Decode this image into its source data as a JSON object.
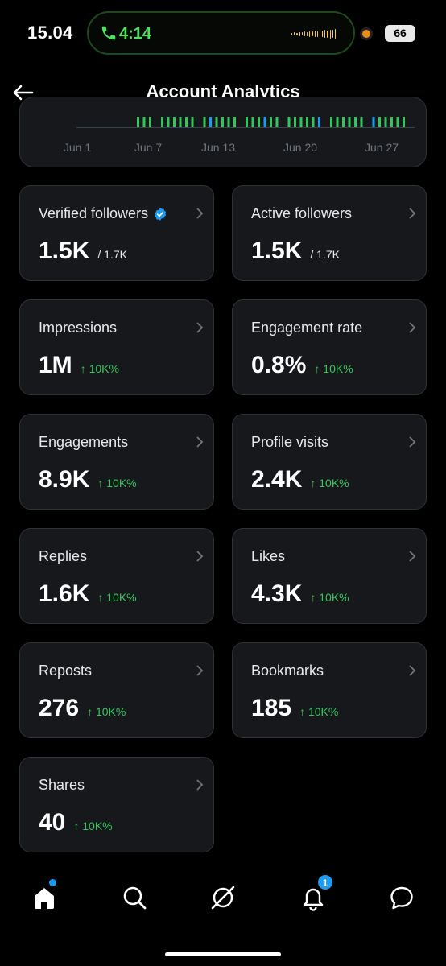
{
  "status_bar": {
    "time": "15.04",
    "call_time": "4:14",
    "battery": "66"
  },
  "header": {
    "title": "Account Analytics"
  },
  "chart": {
    "x_tick_labels": [
      "Jun 1",
      "Jun 7",
      "Jun 13",
      "Jun 20",
      "Jun 27"
    ],
    "bar_color": "#36c55d",
    "highlight_color": "#1d9bf0"
  },
  "cards": [
    {
      "label": "Verified followers",
      "value": "1.5K",
      "sub": "/ 1.7K",
      "delta": ""
    },
    {
      "label": "Active followers",
      "value": "1.5K",
      "sub": "/ 1.7K",
      "delta": ""
    },
    {
      "label": "Impressions",
      "value": "1M",
      "sub": "",
      "delta": "↑ 10K%"
    },
    {
      "label": "Engagement rate",
      "value": "0.8%",
      "sub": "",
      "delta": "↑ 10K%"
    },
    {
      "label": "Engagements",
      "value": "8.9K",
      "sub": "",
      "delta": "↑ 10K%"
    },
    {
      "label": "Profile visits",
      "value": "2.4K",
      "sub": "",
      "delta": "↑ 10K%"
    },
    {
      "label": "Replies",
      "value": "1.6K",
      "sub": "",
      "delta": "↑ 10K%"
    },
    {
      "label": "Likes",
      "value": "4.3K",
      "sub": "",
      "delta": "↑ 10K%"
    },
    {
      "label": "Reposts",
      "value": "276",
      "sub": "",
      "delta": "↑ 10K%"
    },
    {
      "label": "Bookmarks",
      "value": "185",
      "sub": "",
      "delta": "↑ 10K%"
    },
    {
      "label": "Shares",
      "value": "40",
      "sub": "",
      "delta": "↑ 10K%"
    }
  ],
  "nav": {
    "items": [
      "home-icon",
      "search-icon",
      "grok-icon",
      "notifications-icon",
      "messages-icon"
    ],
    "notifications_badge": "1"
  },
  "colors": {
    "accent": "#1d9bf0",
    "positive": "#36c55d",
    "card_bg": "#16181c",
    "border": "#2f3336"
  }
}
